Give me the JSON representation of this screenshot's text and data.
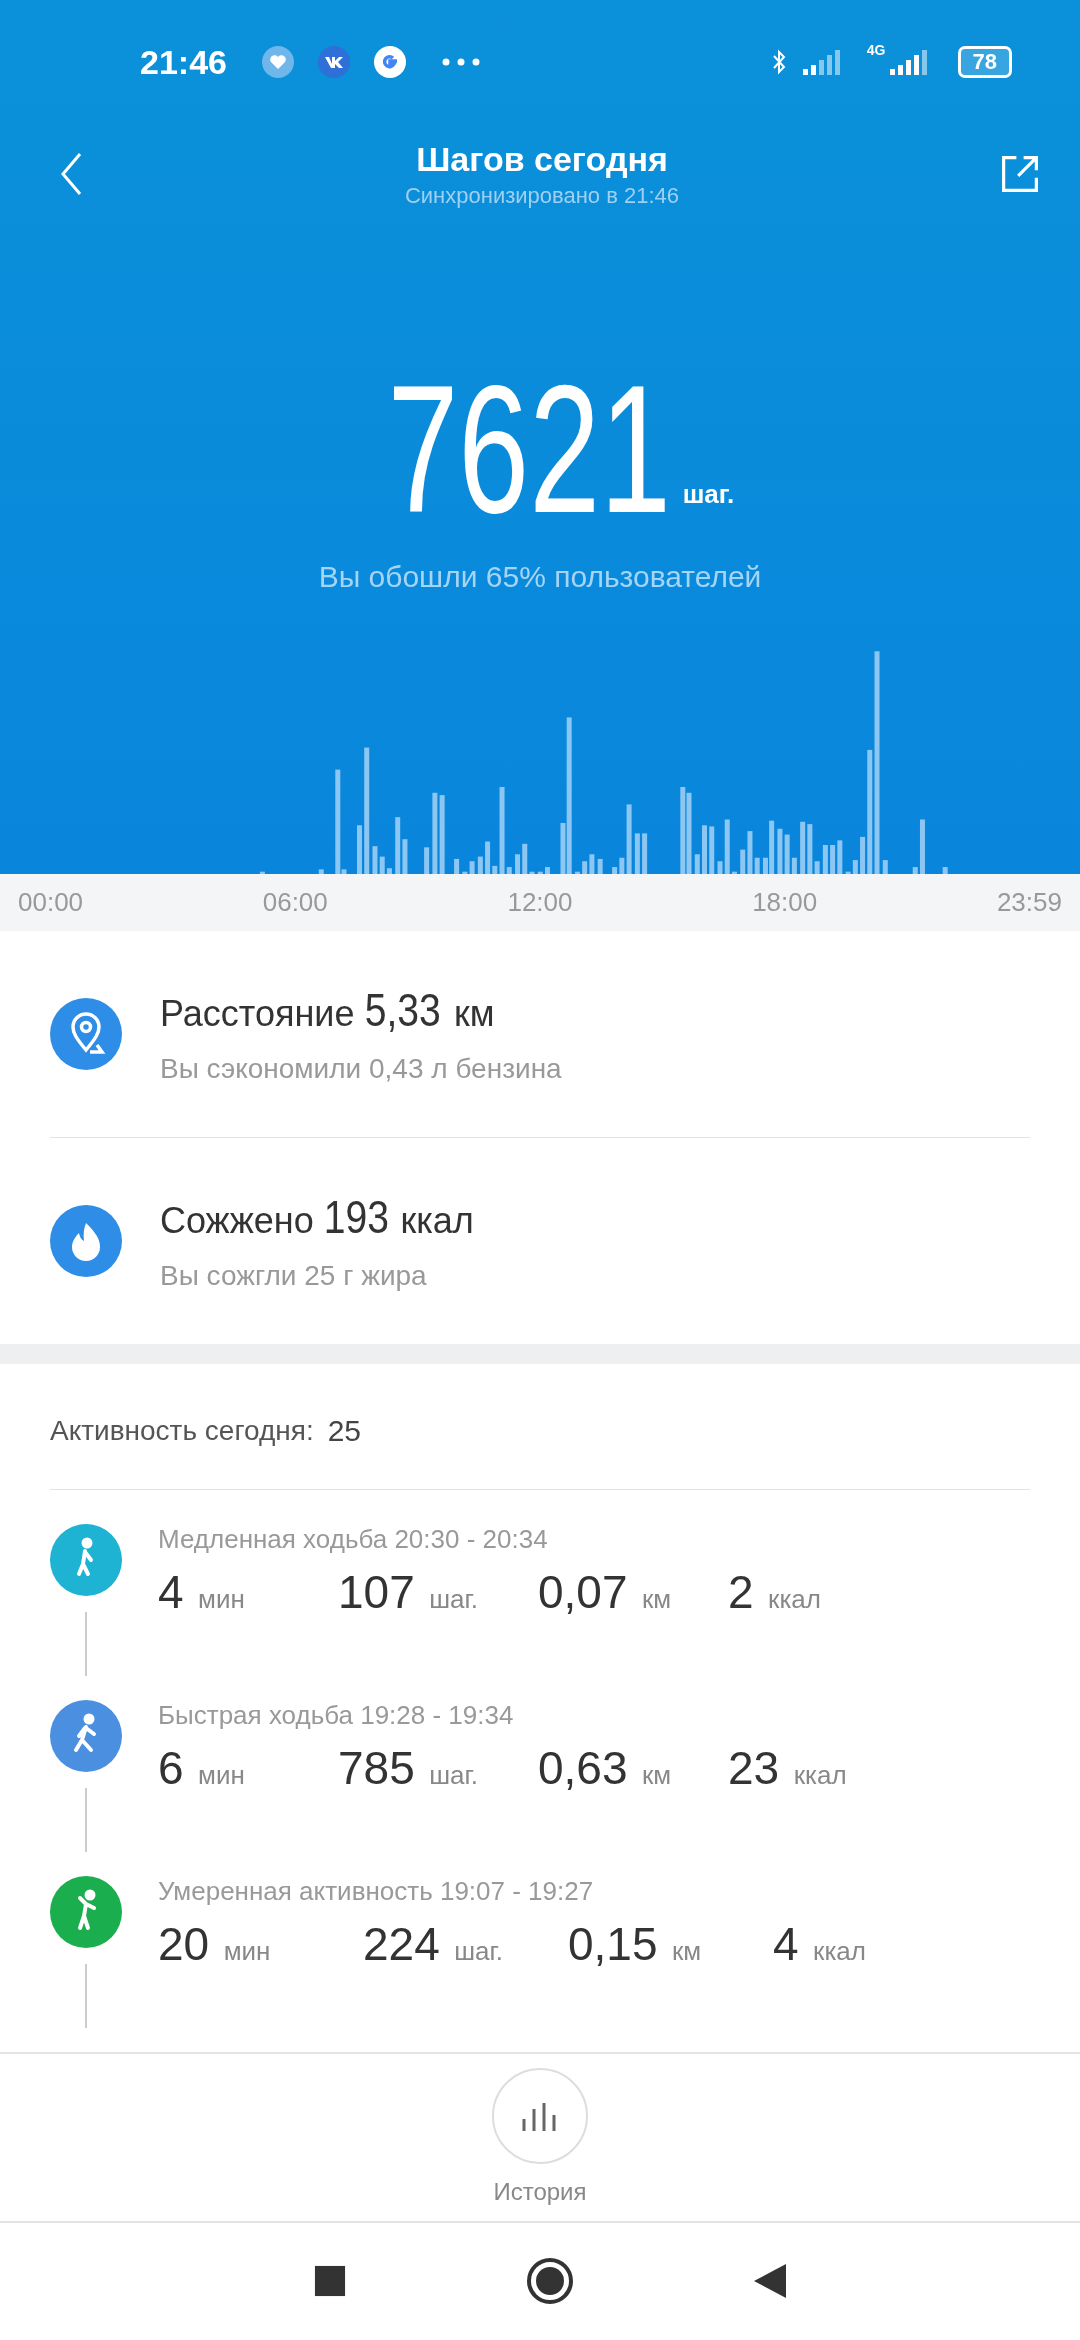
{
  "status_bar": {
    "time": "21:46",
    "network": "4G",
    "battery": "78"
  },
  "header": {
    "title": "Шагов сегодня",
    "subtitle": "Синхронизировано в 21:46"
  },
  "summary": {
    "steps": "7621",
    "unit": "шаг.",
    "comparison": "Вы обошли 65% пользователей"
  },
  "chart_axis": [
    "00:00",
    "06:00",
    "12:00",
    "18:00",
    "23:59"
  ],
  "stats": [
    {
      "kind": "distance",
      "label": "Расстояние",
      "value": "5,33",
      "unit": "км",
      "note": "Вы сэкономили 0,43 л бензина"
    },
    {
      "kind": "calories",
      "label": "Сожжено",
      "value": "193",
      "unit": "ккал",
      "note": "Вы сожгли 25 г жира"
    }
  ],
  "activity": {
    "label": "Активность сегодня:",
    "count": "25",
    "items": [
      {
        "kind": "slow_walk",
        "color": "#1eb3d3",
        "title": "Медленная ходьба 20:30 - 20:34",
        "metrics": [
          {
            "value": "4",
            "unit": "мин"
          },
          {
            "value": "107",
            "unit": "шаг."
          },
          {
            "value": "0,07",
            "unit": "км"
          },
          {
            "value": "2",
            "unit": "ккал"
          }
        ]
      },
      {
        "kind": "fast_walk",
        "color": "#4a8fe0",
        "title": "Быстрая ходьба 19:28 - 19:34",
        "metrics": [
          {
            "value": "6",
            "unit": "мин"
          },
          {
            "value": "785",
            "unit": "шаг."
          },
          {
            "value": "0,63",
            "unit": "км"
          },
          {
            "value": "23",
            "unit": "ккал"
          }
        ]
      },
      {
        "kind": "moderate",
        "color": "#1bae4e",
        "title": "Умеренная активность 19:07 - 19:27",
        "metrics": [
          {
            "value": "20",
            "unit": "мин"
          },
          {
            "value": "224",
            "unit": "шаг."
          },
          {
            "value": "0,15",
            "unit": "км"
          },
          {
            "value": "4",
            "unit": "ккал"
          }
        ]
      }
    ]
  },
  "history_button": {
    "label": "История"
  }
}
